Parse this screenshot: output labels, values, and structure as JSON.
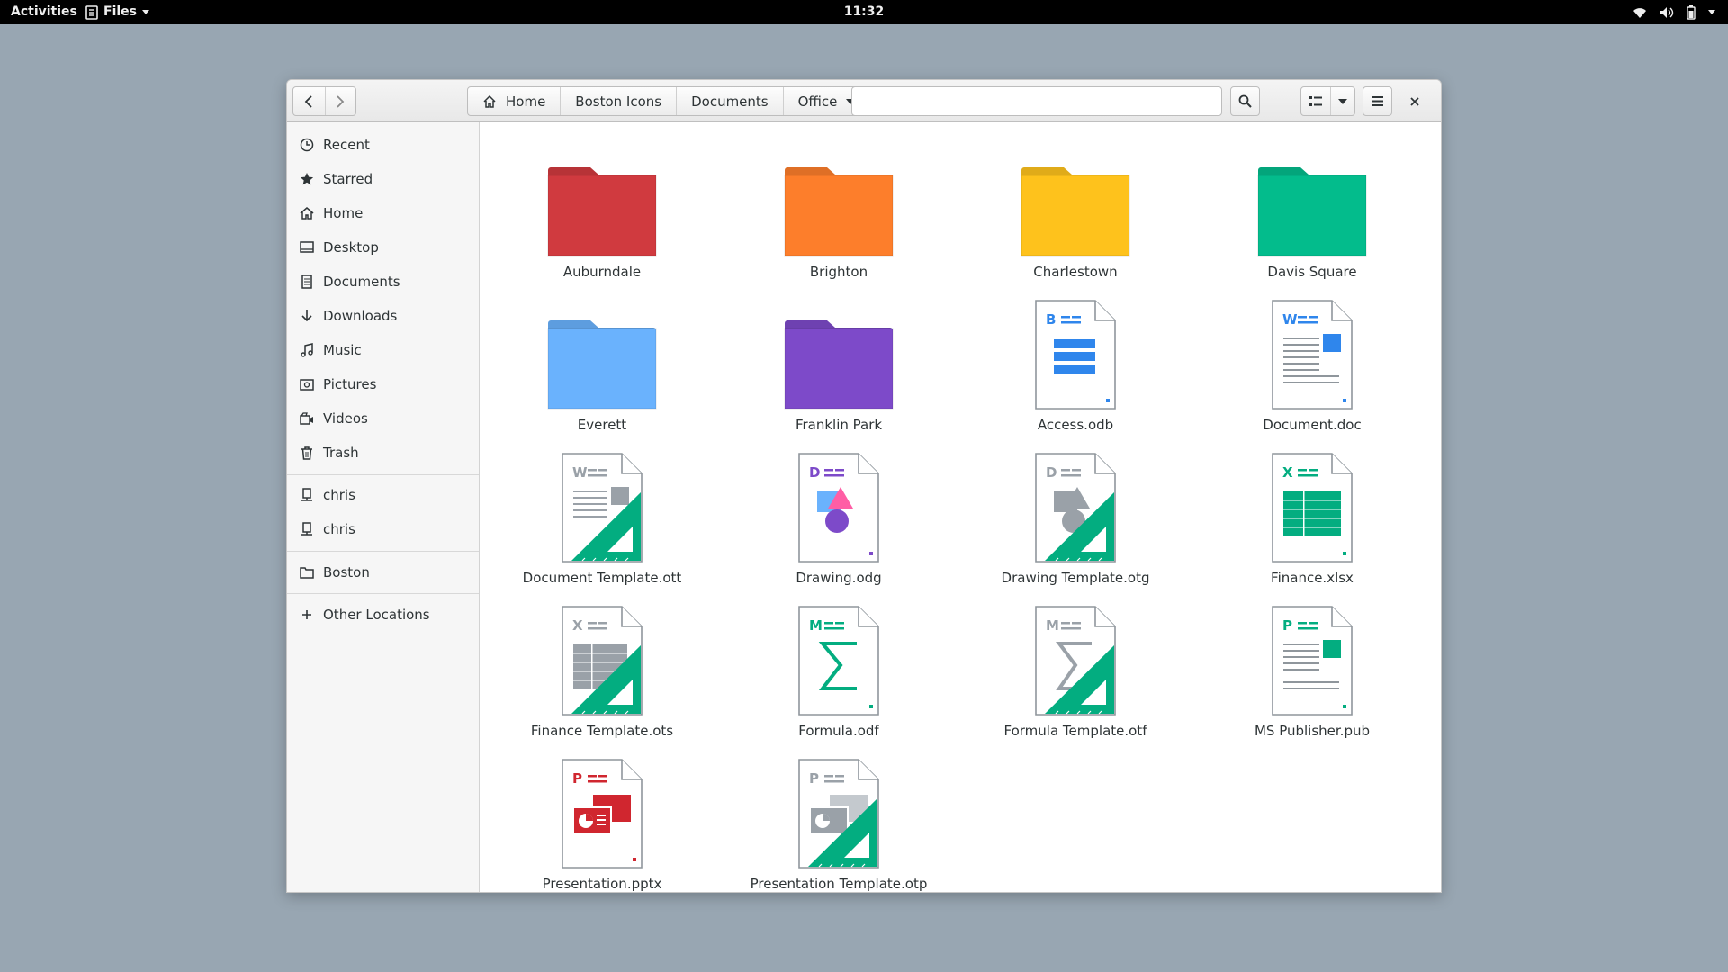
{
  "topbar": {
    "activities": "Activities",
    "app_name": "Files",
    "clock": "11:32",
    "icons": [
      "wifi-icon",
      "volume-icon",
      "battery-icon",
      "power-menu-icon"
    ]
  },
  "toolbar": {
    "breadcrumbs": [
      "Home",
      "Boston Icons",
      "Documents",
      "Office"
    ],
    "icons": [
      "back-icon",
      "forward-icon",
      "home-icon",
      "search-icon",
      "list-view-icon",
      "view-options-icon",
      "hamburger-menu-icon",
      "close-icon"
    ]
  },
  "sidebar": {
    "places": [
      {
        "label": "Recent",
        "icon": "clock-icon"
      },
      {
        "label": "Starred",
        "icon": "star-icon"
      },
      {
        "label": "Home",
        "icon": "home-icon"
      },
      {
        "label": "Desktop",
        "icon": "desktop-icon"
      },
      {
        "label": "Documents",
        "icon": "documents-icon"
      },
      {
        "label": "Downloads",
        "icon": "download-icon"
      },
      {
        "label": "Music",
        "icon": "music-icon"
      },
      {
        "label": "Pictures",
        "icon": "pictures-icon"
      },
      {
        "label": "Videos",
        "icon": "videos-icon"
      },
      {
        "label": "Trash",
        "icon": "trash-icon"
      }
    ],
    "devices": [
      {
        "label": "chris",
        "icon": "drive-icon"
      },
      {
        "label": "chris",
        "icon": "drive-icon"
      }
    ],
    "bookmarks": [
      {
        "label": "Boston",
        "icon": "folder-icon"
      }
    ],
    "other": {
      "label": "Other Locations",
      "icon": "plus-icon"
    }
  },
  "files": [
    {
      "name": "Auburndale",
      "type": "folder",
      "color": "#d03a3f"
    },
    {
      "name": "Brighton",
      "type": "folder",
      "color": "#fd7e2b"
    },
    {
      "name": "Charlestown",
      "type": "folder",
      "color": "#fec21c"
    },
    {
      "name": "Davis Square",
      "type": "folder",
      "color": "#03bc8c"
    },
    {
      "name": "Everett",
      "type": "folder",
      "color": "#6ab2fd"
    },
    {
      "name": "Franklin Park",
      "type": "folder",
      "color": "#7d4ac9"
    },
    {
      "name": "Access.odb",
      "type": "base",
      "letter": "B",
      "color": "#2f86ec"
    },
    {
      "name": "Document.doc",
      "type": "writer",
      "letter": "W",
      "color": "#2f86ec"
    },
    {
      "name": "Document Template.ott",
      "type": "writer-template",
      "letter": "W",
      "color": "#9aa1a8"
    },
    {
      "name": "Drawing.odg",
      "type": "draw",
      "letter": "D",
      "color": "#7d4ac9"
    },
    {
      "name": "Drawing Template.otg",
      "type": "draw-template",
      "letter": "D",
      "color": "#9aa1a8"
    },
    {
      "name": "Finance.xlsx",
      "type": "calc",
      "letter": "X",
      "color": "#03ad80"
    },
    {
      "name": "Finance Template.ots",
      "type": "calc-template",
      "letter": "X",
      "color": "#9aa1a8"
    },
    {
      "name": "Formula.odf",
      "type": "math",
      "letter": "M",
      "color": "#03ad80"
    },
    {
      "name": "Formula Template.otf",
      "type": "math-template",
      "letter": "M",
      "color": "#9aa1a8"
    },
    {
      "name": "MS Publisher.pub",
      "type": "publisher",
      "letter": "P",
      "color": "#03ad80"
    },
    {
      "name": "Presentation.pptx",
      "type": "impress",
      "letter": "P",
      "color": "#d0262f"
    },
    {
      "name": "Presentation Template.otp",
      "type": "impress-template",
      "letter": "P",
      "color": "#9aa1a8"
    }
  ]
}
